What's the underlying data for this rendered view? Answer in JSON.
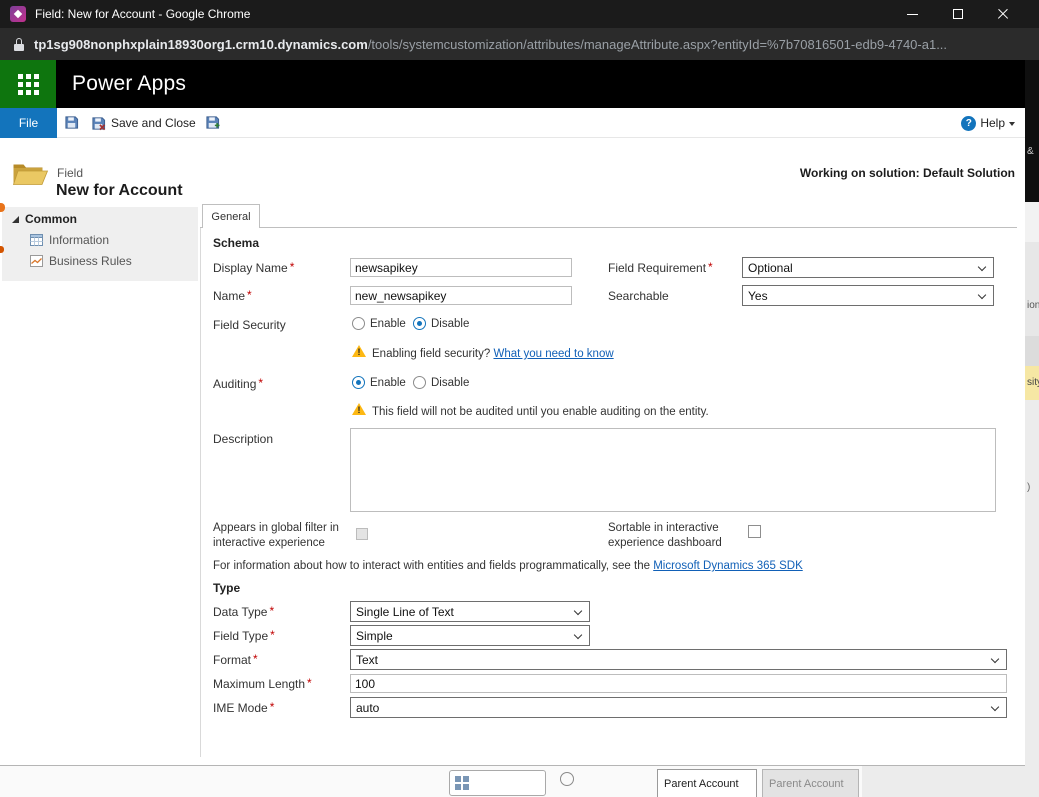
{
  "window": {
    "title": "Field: New for Account - Google Chrome"
  },
  "browser": {
    "url_domain": "tp1sg908nonphxplain18930org1.crm10.dynamics.com",
    "url_path": "/tools/systemcustomization/attributes/manageAttribute.aspx?entityId=%7b70816501-edb9-4740-a1..."
  },
  "app_header": {
    "title": "Power Apps"
  },
  "toolbar": {
    "file": "File",
    "save_and_close": "Save and Close",
    "help": "Help"
  },
  "form_header": {
    "record_type": "Field",
    "title": "New for Account",
    "solution": "Working on solution: Default Solution"
  },
  "sidebar": {
    "group": "Common",
    "items": [
      {
        "label": "Information"
      },
      {
        "label": "Business Rules"
      }
    ]
  },
  "tab": {
    "general": "General"
  },
  "required_marker": "*",
  "schema": {
    "title": "Schema",
    "display_name_label": "Display Name",
    "display_name_value": "newsapikey",
    "field_requirement_label": "Field Requirement",
    "field_requirement_value": "Optional",
    "name_label": "Name",
    "name_value": "new_newsapikey",
    "searchable_label": "Searchable",
    "searchable_value": "Yes",
    "field_security_label": "Field Security",
    "enable_label": "Enable",
    "disable_label": "Disable",
    "field_security_selected": "Disable",
    "security_warning_text": "Enabling field security?",
    "security_warning_link": "What you need to know",
    "auditing_label": "Auditing",
    "auditing_selected": "Enable",
    "auditing_warning_text": "This field will not be audited until you enable auditing on the entity.",
    "description_label": "Description",
    "description_value": "",
    "global_filter_label": "Appears in global filter in interactive experience",
    "sortable_label": "Sortable in interactive experience dashboard",
    "sdk_text": "For information about how to interact with entities and fields programmatically, see the ",
    "sdk_link": "Microsoft Dynamics 365 SDK"
  },
  "type_section": {
    "title": "Type",
    "data_type_label": "Data Type",
    "data_type_value": "Single Line of Text",
    "field_type_label": "Field Type",
    "field_type_value": "Simple",
    "format_label": "Format",
    "format_value": "Text",
    "maximum_length_label": "Maximum Length",
    "maximum_length_value": "100",
    "ime_mode_label": "IME Mode",
    "ime_mode_value": "auto"
  },
  "icons": {
    "help_glyph": "?",
    "warning_glyph": "!"
  },
  "background": {
    "fragment_amp": "&",
    "fragment_ion": "ion",
    "fragment_sity": "sity",
    "fragment_paren": ")",
    "parent_account_1": "Parent Account",
    "parent_account_2": "Parent Account"
  }
}
